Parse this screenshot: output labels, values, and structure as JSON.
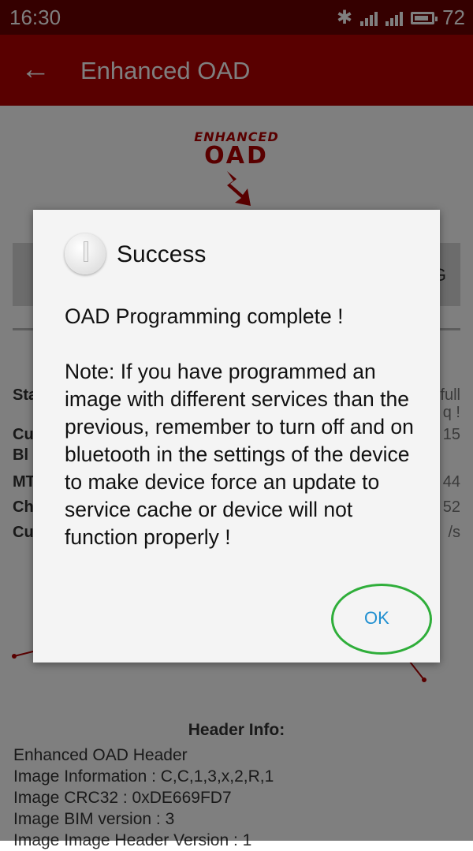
{
  "status_bar": {
    "time": "16:30",
    "battery": "72"
  },
  "app_bar": {
    "title": "Enhanced OAD"
  },
  "logo": {
    "line1": "ENHANCED",
    "line2": "OAD"
  },
  "program_button": {
    "label_fragment": "G"
  },
  "info_rows": [
    {
      "label": "Sta",
      "value": "full"
    },
    {
      "label": "Cu",
      "value": "q !"
    },
    {
      "label": "Bl",
      "value": "15"
    },
    {
      "label": "MT",
      "value": "44"
    },
    {
      "label": "Ch",
      "value": "52"
    },
    {
      "label": "Cu",
      "value": "/s"
    }
  ],
  "header_info": {
    "title": "Header Info:",
    "lines": [
      "Enhanced OAD Header",
      "Image Information : C,C,1,3,x,2,R,1",
      "Image CRC32 : 0xDE669FD7",
      "Image BIM version : 3",
      "Image Image Header Version : 1"
    ]
  },
  "dialog": {
    "title": "Success",
    "message": "OAD Programming complete !\n\nNote: If you have programmed an image with different services than the previous, remember to turn off and on bluetooth in the settings of the device to make device force an update to service cache or device will not function properly !",
    "ok_label": "OK"
  },
  "colors": {
    "status_bar": "#6b0000",
    "app_bar": "#b20000",
    "accent": "#1f8fd0",
    "annotation": "#2fae3a"
  }
}
